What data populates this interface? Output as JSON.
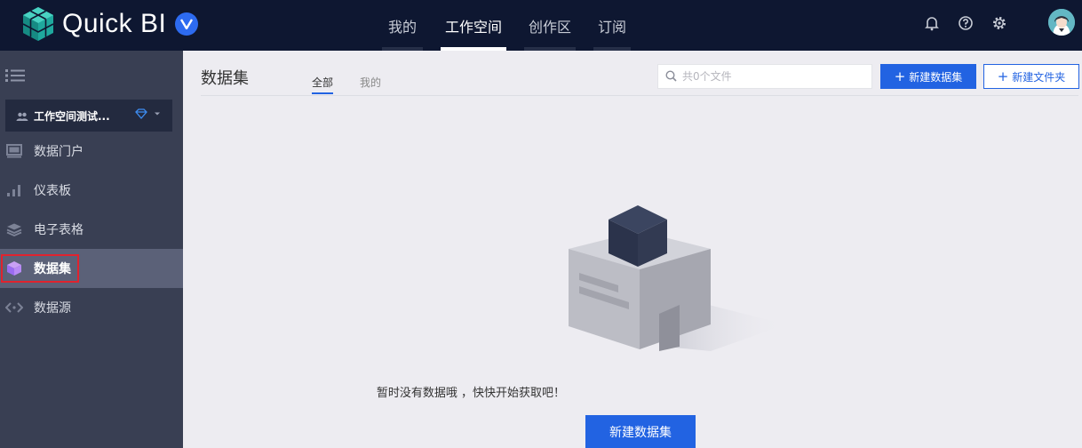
{
  "app": {
    "logo_text": "Quick BI",
    "logo_badge": "V"
  },
  "nav": {
    "items": [
      {
        "label": "我的"
      },
      {
        "label": "工作空间",
        "active": true
      },
      {
        "label": "创作区"
      },
      {
        "label": "订阅"
      }
    ]
  },
  "top_icons": [
    "bell-icon",
    "help-icon",
    "gear-icon",
    "avatar"
  ],
  "sidebar": {
    "workspace_label": "工作空间测试...",
    "items": [
      {
        "label": "数据门户",
        "icon": "portal-icon"
      },
      {
        "label": "仪表板",
        "icon": "bar-chart-icon"
      },
      {
        "label": "电子表格",
        "icon": "layers-icon"
      },
      {
        "label": "数据集",
        "icon": "cube-icon",
        "active": true
      },
      {
        "label": "数据源",
        "icon": "code-arrows-icon"
      }
    ]
  },
  "main": {
    "title": "数据集",
    "tabs": [
      {
        "label": "全部",
        "active": true
      },
      {
        "label": "我的"
      }
    ],
    "search_placeholder": "共0个文件",
    "new_dataset_label": "新建数据集",
    "new_folder_label": "新建文件夹",
    "empty_text": "暂时没有数据哦 ，快快开始获取吧！",
    "cta_label": "新建数据集"
  },
  "colors": {
    "topbar": "#0e1731",
    "sidebar": "#393f53",
    "accent": "#2263e2",
    "highlight_box": "#e0232e"
  }
}
